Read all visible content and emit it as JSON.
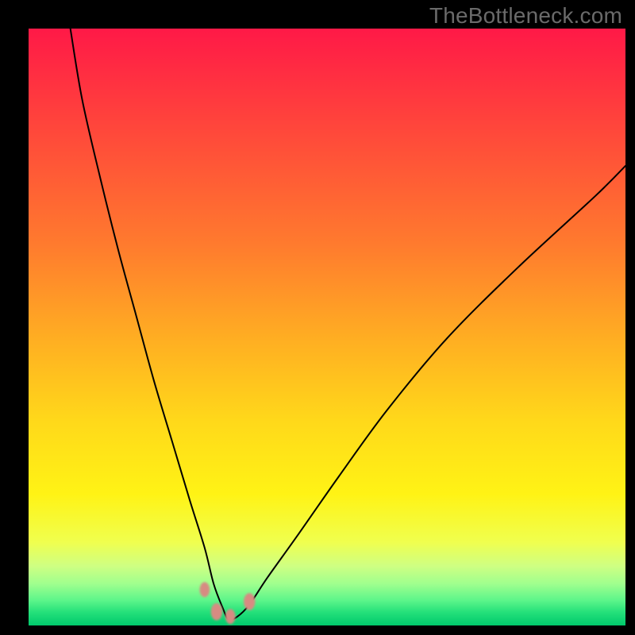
{
  "watermark": "TheBottleneck.com",
  "chart_data": {
    "type": "line",
    "title": "",
    "xlabel": "",
    "ylabel": "",
    "xlim": [
      0,
      100
    ],
    "ylim": [
      0,
      100
    ],
    "note": "No axis tick labels shown. Values below are relative percentages read by position within the plot area (0–100 each axis). A V-shaped curve with vertex near the bottom; left branch steeper than right. Vertex sits around x≈33, y≈0. Small salmon markers overlay the curve near the vertex.",
    "series": [
      {
        "name": "main-curve",
        "x": [
          7,
          9,
          12,
          15,
          18,
          21,
          24,
          27,
          29.5,
          31,
          32.5,
          33.5,
          35,
          37,
          40,
          45,
          52,
          60,
          70,
          82,
          95,
          100
        ],
        "y": [
          100,
          88,
          75,
          63,
          52,
          41,
          31,
          21,
          13,
          7,
          3,
          1,
          1.5,
          3.5,
          8,
          15,
          25,
          36,
          48,
          60,
          72,
          77
        ],
        "style": {
          "stroke": "#000000",
          "stroke_width": 2
        }
      }
    ],
    "markers": [
      {
        "x": 29.5,
        "y": 6.0,
        "r": 7
      },
      {
        "x": 31.5,
        "y": 2.3,
        "r": 8
      },
      {
        "x": 33.8,
        "y": 1.5,
        "r": 7
      },
      {
        "x": 37.0,
        "y": 4.0,
        "r": 8
      }
    ],
    "marker_style": {
      "fill": "#d78b82",
      "blur": 1.4
    },
    "background_gradient": {
      "type": "vertical",
      "stops": [
        {
          "offset": 0.0,
          "color": "#ff1947"
        },
        {
          "offset": 0.18,
          "color": "#ff4a3a"
        },
        {
          "offset": 0.36,
          "color": "#ff7a2e"
        },
        {
          "offset": 0.52,
          "color": "#ffae22"
        },
        {
          "offset": 0.66,
          "color": "#ffd91a"
        },
        {
          "offset": 0.78,
          "color": "#fff315"
        },
        {
          "offset": 0.86,
          "color": "#f0ff4e"
        },
        {
          "offset": 0.9,
          "color": "#cfff82"
        },
        {
          "offset": 0.93,
          "color": "#a0ff8e"
        },
        {
          "offset": 0.958,
          "color": "#5cf58a"
        },
        {
          "offset": 0.978,
          "color": "#24e07a"
        },
        {
          "offset": 1.0,
          "color": "#00c96c"
        }
      ]
    }
  }
}
